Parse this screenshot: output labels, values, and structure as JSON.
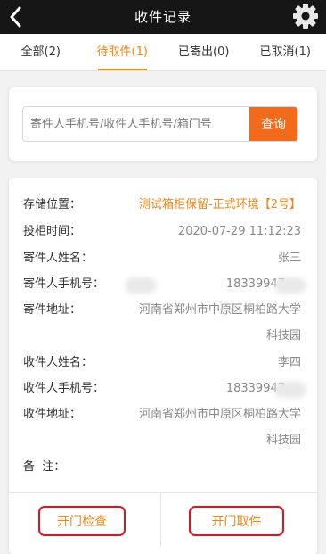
{
  "header": {
    "title": "收件记录",
    "back_icon": "chevron-left-icon",
    "settings_icon": "gear-icon"
  },
  "tabs": [
    {
      "label": "全部(2)",
      "active": false
    },
    {
      "label": "待取件(1)",
      "active": true
    },
    {
      "label": "已寄出(0)",
      "active": false
    },
    {
      "label": "已取消(1)",
      "active": false
    }
  ],
  "search": {
    "placeholder": "寄件人手机号/收件人手机号/箱门号",
    "button_label": "查询"
  },
  "record": {
    "storage_label": "存储位置：",
    "storage_value": "测试箱柜保留-正式环境【2号】",
    "time_label": "投柜时间：",
    "time_value": "2020-07-29 11:12:23",
    "sender_name_label": "寄件人姓名：",
    "sender_name_value": "张三",
    "sender_phone_label": "寄件人手机号：",
    "sender_phone_value": "18339947",
    "sender_addr_label": "寄件地址：",
    "sender_addr_line1": "河南省郑州市中原区桐柏路大学",
    "sender_addr_line2": "科技园",
    "receiver_name_label": "收件人姓名：",
    "receiver_name_value": "李四",
    "receiver_phone_label": "收件人手机号：",
    "receiver_phone_value": "18339947",
    "receiver_addr_label": "收件地址：",
    "receiver_addr_line1": "河南省郑州市中原区桐柏路大学",
    "receiver_addr_line2": "科技园",
    "remark_label": "备  注："
  },
  "actions": {
    "check_label": "开门检查",
    "pickup_label": "开门取件"
  },
  "colors": {
    "accent": "#f08519",
    "button_orange": "#f26b1d",
    "highlight_red": "#e0141f",
    "header_bg": "#161616"
  }
}
